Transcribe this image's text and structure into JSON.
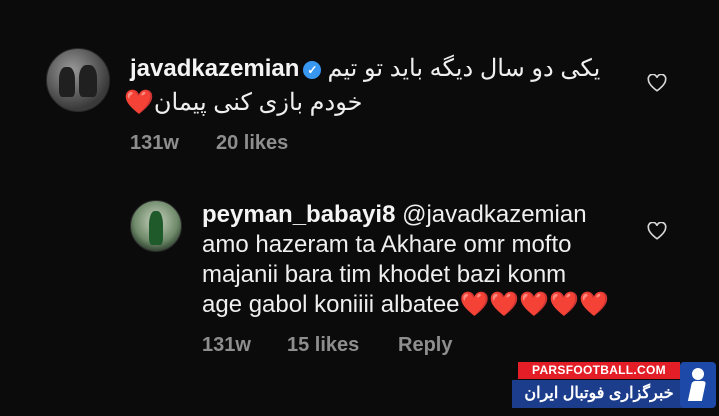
{
  "comments": [
    {
      "username": "javadkazemian",
      "verified": true,
      "text_line1": "یکی دو سال دیگه باید تو تیم",
      "text_line2": "خودم بازی کنی پیمان",
      "emoji": "❤️",
      "time": "131w",
      "likes": "20 likes"
    },
    {
      "username": "peyman_babayi8",
      "mention": "@javadkazemian",
      "lines": [
        "amo hazeram  ta Akhare omr  mofto",
        "majanii bara  tim  khodet bazi konm",
        "age gabol koniiii albatee"
      ],
      "hearts": "❤️❤️❤️❤️❤️",
      "time": "131w",
      "likes": "15 likes",
      "reply": "Reply"
    }
  ],
  "watermark": {
    "site": "PARSFOOTBALL.COM",
    "name": "خبرگزاری فوتبال ایران"
  },
  "colors": {
    "background": "#0b0b0b",
    "meta": "#8e8e8e",
    "heart": "#e8283a",
    "verified": "#3897f0"
  }
}
